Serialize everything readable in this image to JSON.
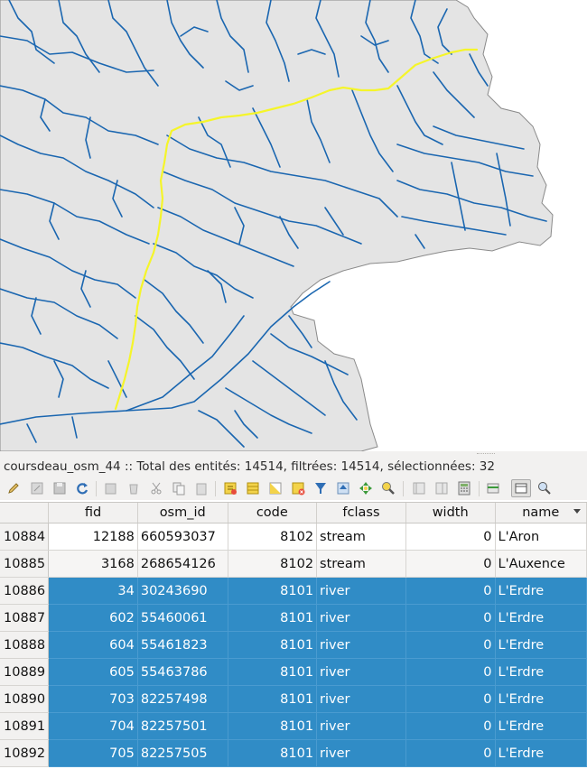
{
  "layer_summary": "coursdeau_osm_44 :: Total des entités: 14514, filtrées: 14514, sélectionnées: 32",
  "colors": {
    "river": "#1a66b0",
    "selected_river": "#f5f52a",
    "land": "#e4e4e4",
    "selection": "#308cc6"
  },
  "toolbar_icons": [
    "edit-pencil-icon",
    "multi-edit-icon",
    "save-edits-icon",
    "reload-icon",
    "add-feature-icon",
    "delete-feature-icon",
    "cut-icon",
    "copy-icon",
    "paste-icon",
    "expression-select-icon",
    "select-all-icon",
    "invert-selection-icon",
    "deselect-all-icon",
    "filter-selection-icon",
    "move-selection-top-icon",
    "pan-to-selection-icon",
    "zoom-to-selection-icon",
    "new-field-icon",
    "delete-field-icon",
    "field-calculator-icon",
    "conditional-formatting-icon",
    "dock-table-icon",
    "actions-icon"
  ],
  "table": {
    "columns": [
      "fid",
      "osm_id",
      "code",
      "fclass",
      "width",
      "name"
    ],
    "rows": [
      {
        "row": "10884",
        "fid": "12188",
        "osm_id": "660593037",
        "code": "8102",
        "fclass": "stream",
        "width": "0",
        "name": "L'Aron",
        "selected": false
      },
      {
        "row": "10885",
        "fid": "3168",
        "osm_id": "268654126",
        "code": "8102",
        "fclass": "stream",
        "width": "0",
        "name": "L'Auxence",
        "selected": false
      },
      {
        "row": "10886",
        "fid": "34",
        "osm_id": "30243690",
        "code": "8101",
        "fclass": "river",
        "width": "0",
        "name": "L'Erdre",
        "selected": true
      },
      {
        "row": "10887",
        "fid": "602",
        "osm_id": "55460061",
        "code": "8101",
        "fclass": "river",
        "width": "0",
        "name": "L'Erdre",
        "selected": true
      },
      {
        "row": "10888",
        "fid": "604",
        "osm_id": "55461823",
        "code": "8101",
        "fclass": "river",
        "width": "0",
        "name": "L'Erdre",
        "selected": true
      },
      {
        "row": "10889",
        "fid": "605",
        "osm_id": "55463786",
        "code": "8101",
        "fclass": "river",
        "width": "0",
        "name": "L'Erdre",
        "selected": true
      },
      {
        "row": "10890",
        "fid": "703",
        "osm_id": "82257498",
        "code": "8101",
        "fclass": "river",
        "width": "0",
        "name": "L'Erdre",
        "selected": true
      },
      {
        "row": "10891",
        "fid": "704",
        "osm_id": "82257501",
        "code": "8101",
        "fclass": "river",
        "width": "0",
        "name": "L'Erdre",
        "selected": true
      },
      {
        "row": "10892",
        "fid": "705",
        "osm_id": "82257505",
        "code": "8101",
        "fclass": "river",
        "width": "0",
        "name": "L'Erdre",
        "selected": true
      }
    ]
  }
}
